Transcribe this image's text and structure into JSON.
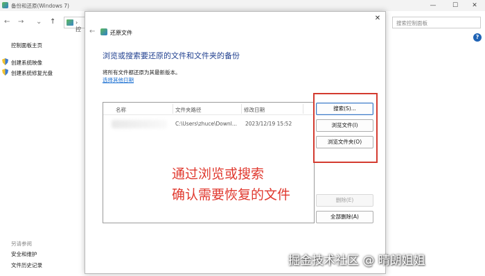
{
  "window": {
    "title": "备份和还原(Windows 7)",
    "controls": {
      "minimize": "—",
      "maximize": "☐",
      "close": "✕"
    }
  },
  "toolbar": {
    "back": "←",
    "forward": "→",
    "dropdown": "⌄",
    "up": "↑",
    "address_partial": "› 控",
    "search_placeholder": "搜索控制面板",
    "help": "?"
  },
  "sidebar": {
    "home": "控制面板主页",
    "items": [
      {
        "label": "创建系统映像"
      },
      {
        "label": "创建系统修复光盘"
      }
    ],
    "see_also_title": "另请参阅",
    "see_also": [
      {
        "label": "安全和维护"
      },
      {
        "label": "文件历史记录"
      }
    ]
  },
  "dialog": {
    "title": "还原文件",
    "close": "✕",
    "back": "←",
    "heading": "浏览或搜索要还原的文件和文件夹的备份",
    "description": "将所有文件都还原为其最新版本。",
    "choose_date_link": "选择其他日期",
    "columns": [
      "名称",
      "文件夹路径",
      "修改日期"
    ],
    "rows": [
      {
        "name": "",
        "path": "C:\\Users\\zhuce\\Downl...",
        "date": "2023/12/19 15:52"
      }
    ],
    "buttons": {
      "search": "搜索(S)...",
      "browse_files": "浏览文件(I)",
      "browse_folders": "浏览文件夹(O)",
      "remove": "删除(E)",
      "remove_all": "全部删除(A)"
    }
  },
  "annotation": {
    "line1": "通过浏览或搜索",
    "line2": "确认需要恢复的文件",
    "color": "#e0392f"
  },
  "watermark": "掘金技术社区 @ 晴朗姐姐"
}
